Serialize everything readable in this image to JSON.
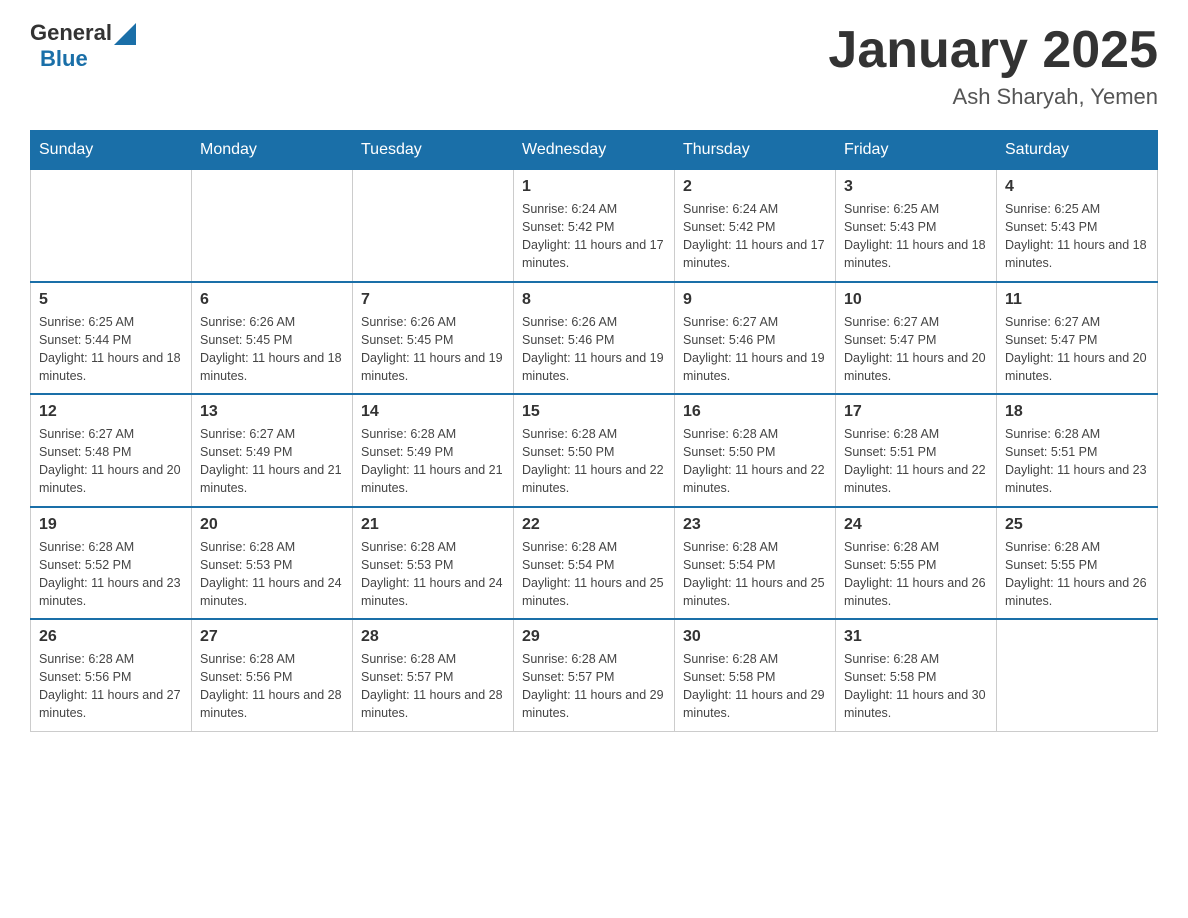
{
  "header": {
    "logo_general": "General",
    "logo_blue": "Blue",
    "month_title": "January 2025",
    "location": "Ash Sharyah, Yemen"
  },
  "weekdays": [
    "Sunday",
    "Monday",
    "Tuesday",
    "Wednesday",
    "Thursday",
    "Friday",
    "Saturday"
  ],
  "weeks": [
    [
      {
        "day": "",
        "sunrise": "",
        "sunset": "",
        "daylight": ""
      },
      {
        "day": "",
        "sunrise": "",
        "sunset": "",
        "daylight": ""
      },
      {
        "day": "",
        "sunrise": "",
        "sunset": "",
        "daylight": ""
      },
      {
        "day": "1",
        "sunrise": "Sunrise: 6:24 AM",
        "sunset": "Sunset: 5:42 PM",
        "daylight": "Daylight: 11 hours and 17 minutes."
      },
      {
        "day": "2",
        "sunrise": "Sunrise: 6:24 AM",
        "sunset": "Sunset: 5:42 PM",
        "daylight": "Daylight: 11 hours and 17 minutes."
      },
      {
        "day": "3",
        "sunrise": "Sunrise: 6:25 AM",
        "sunset": "Sunset: 5:43 PM",
        "daylight": "Daylight: 11 hours and 18 minutes."
      },
      {
        "day": "4",
        "sunrise": "Sunrise: 6:25 AM",
        "sunset": "Sunset: 5:43 PM",
        "daylight": "Daylight: 11 hours and 18 minutes."
      }
    ],
    [
      {
        "day": "5",
        "sunrise": "Sunrise: 6:25 AM",
        "sunset": "Sunset: 5:44 PM",
        "daylight": "Daylight: 11 hours and 18 minutes."
      },
      {
        "day": "6",
        "sunrise": "Sunrise: 6:26 AM",
        "sunset": "Sunset: 5:45 PM",
        "daylight": "Daylight: 11 hours and 18 minutes."
      },
      {
        "day": "7",
        "sunrise": "Sunrise: 6:26 AM",
        "sunset": "Sunset: 5:45 PM",
        "daylight": "Daylight: 11 hours and 19 minutes."
      },
      {
        "day": "8",
        "sunrise": "Sunrise: 6:26 AM",
        "sunset": "Sunset: 5:46 PM",
        "daylight": "Daylight: 11 hours and 19 minutes."
      },
      {
        "day": "9",
        "sunrise": "Sunrise: 6:27 AM",
        "sunset": "Sunset: 5:46 PM",
        "daylight": "Daylight: 11 hours and 19 minutes."
      },
      {
        "day": "10",
        "sunrise": "Sunrise: 6:27 AM",
        "sunset": "Sunset: 5:47 PM",
        "daylight": "Daylight: 11 hours and 20 minutes."
      },
      {
        "day": "11",
        "sunrise": "Sunrise: 6:27 AM",
        "sunset": "Sunset: 5:47 PM",
        "daylight": "Daylight: 11 hours and 20 minutes."
      }
    ],
    [
      {
        "day": "12",
        "sunrise": "Sunrise: 6:27 AM",
        "sunset": "Sunset: 5:48 PM",
        "daylight": "Daylight: 11 hours and 20 minutes."
      },
      {
        "day": "13",
        "sunrise": "Sunrise: 6:27 AM",
        "sunset": "Sunset: 5:49 PM",
        "daylight": "Daylight: 11 hours and 21 minutes."
      },
      {
        "day": "14",
        "sunrise": "Sunrise: 6:28 AM",
        "sunset": "Sunset: 5:49 PM",
        "daylight": "Daylight: 11 hours and 21 minutes."
      },
      {
        "day": "15",
        "sunrise": "Sunrise: 6:28 AM",
        "sunset": "Sunset: 5:50 PM",
        "daylight": "Daylight: 11 hours and 22 minutes."
      },
      {
        "day": "16",
        "sunrise": "Sunrise: 6:28 AM",
        "sunset": "Sunset: 5:50 PM",
        "daylight": "Daylight: 11 hours and 22 minutes."
      },
      {
        "day": "17",
        "sunrise": "Sunrise: 6:28 AM",
        "sunset": "Sunset: 5:51 PM",
        "daylight": "Daylight: 11 hours and 22 minutes."
      },
      {
        "day": "18",
        "sunrise": "Sunrise: 6:28 AM",
        "sunset": "Sunset: 5:51 PM",
        "daylight": "Daylight: 11 hours and 23 minutes."
      }
    ],
    [
      {
        "day": "19",
        "sunrise": "Sunrise: 6:28 AM",
        "sunset": "Sunset: 5:52 PM",
        "daylight": "Daylight: 11 hours and 23 minutes."
      },
      {
        "day": "20",
        "sunrise": "Sunrise: 6:28 AM",
        "sunset": "Sunset: 5:53 PM",
        "daylight": "Daylight: 11 hours and 24 minutes."
      },
      {
        "day": "21",
        "sunrise": "Sunrise: 6:28 AM",
        "sunset": "Sunset: 5:53 PM",
        "daylight": "Daylight: 11 hours and 24 minutes."
      },
      {
        "day": "22",
        "sunrise": "Sunrise: 6:28 AM",
        "sunset": "Sunset: 5:54 PM",
        "daylight": "Daylight: 11 hours and 25 minutes."
      },
      {
        "day": "23",
        "sunrise": "Sunrise: 6:28 AM",
        "sunset": "Sunset: 5:54 PM",
        "daylight": "Daylight: 11 hours and 25 minutes."
      },
      {
        "day": "24",
        "sunrise": "Sunrise: 6:28 AM",
        "sunset": "Sunset: 5:55 PM",
        "daylight": "Daylight: 11 hours and 26 minutes."
      },
      {
        "day": "25",
        "sunrise": "Sunrise: 6:28 AM",
        "sunset": "Sunset: 5:55 PM",
        "daylight": "Daylight: 11 hours and 26 minutes."
      }
    ],
    [
      {
        "day": "26",
        "sunrise": "Sunrise: 6:28 AM",
        "sunset": "Sunset: 5:56 PM",
        "daylight": "Daylight: 11 hours and 27 minutes."
      },
      {
        "day": "27",
        "sunrise": "Sunrise: 6:28 AM",
        "sunset": "Sunset: 5:56 PM",
        "daylight": "Daylight: 11 hours and 28 minutes."
      },
      {
        "day": "28",
        "sunrise": "Sunrise: 6:28 AM",
        "sunset": "Sunset: 5:57 PM",
        "daylight": "Daylight: 11 hours and 28 minutes."
      },
      {
        "day": "29",
        "sunrise": "Sunrise: 6:28 AM",
        "sunset": "Sunset: 5:57 PM",
        "daylight": "Daylight: 11 hours and 29 minutes."
      },
      {
        "day": "30",
        "sunrise": "Sunrise: 6:28 AM",
        "sunset": "Sunset: 5:58 PM",
        "daylight": "Daylight: 11 hours and 29 minutes."
      },
      {
        "day": "31",
        "sunrise": "Sunrise: 6:28 AM",
        "sunset": "Sunset: 5:58 PM",
        "daylight": "Daylight: 11 hours and 30 minutes."
      },
      {
        "day": "",
        "sunrise": "",
        "sunset": "",
        "daylight": ""
      }
    ]
  ]
}
